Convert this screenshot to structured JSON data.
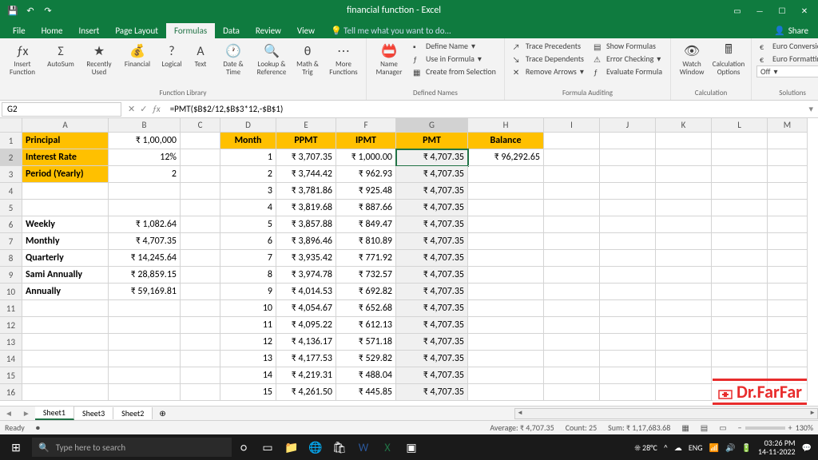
{
  "titlebar": {
    "title": "financial function - Excel"
  },
  "tabs": [
    "File",
    "Home",
    "Insert",
    "Page Layout",
    "Formulas",
    "Data",
    "Review",
    "View"
  ],
  "active_tab": "Formulas",
  "tellme": "Tell me what you want to do...",
  "share": "Share",
  "ribbon": {
    "insertfn": "Insert Function",
    "autosum": "AutoSum",
    "recent": "Recently Used",
    "financial": "Financial",
    "logical": "Logical",
    "text": "Text",
    "datetime": "Date & Time",
    "lookup": "Lookup & Reference",
    "math": "Math & Trig",
    "morefn": "More Functions",
    "g1": "Function Library",
    "namemgr": "Name Manager",
    "defname": "Define Name",
    "useinf": "Use in Formula",
    "createsel": "Create from Selection",
    "g2": "Defined Names",
    "traceprec": "Trace Precedents",
    "tracedep": "Trace Dependents",
    "remarr": "Remove Arrows",
    "showf": "Show Formulas",
    "errchk": "Error Checking",
    "evalf": "Evaluate Formula",
    "g3": "Formula Auditing",
    "watch": "Watch Window",
    "calcopt": "Calculation Options",
    "g4": "Calculation",
    "euroconv": "Euro Conversion",
    "eurofmt": "Euro Formatting",
    "off": "Off",
    "g5": "Solutions"
  },
  "namebox": "G2",
  "formula": "=PMT($B$2/12,$B$3*12,-$B$1)",
  "cols": [
    "A",
    "B",
    "C",
    "D",
    "E",
    "F",
    "G",
    "H",
    "I",
    "J",
    "K",
    "L",
    "M"
  ],
  "labels": {
    "principal": "Principal",
    "irate": "Interest Rate",
    "period": "Period (Yearly)",
    "weekly": "Weekly",
    "monthly": "Monthly",
    "quarterly": "Quarterly",
    "sami": "Sami Annually",
    "annually": "Annually",
    "month": "Month",
    "ppmt": "PPMT",
    "ipmt": "IPMT",
    "pmt": "PMT",
    "balance": "Balance"
  },
  "vals": {
    "principal": "₹ 1,00,000",
    "irate": "12%",
    "period": "2",
    "weekly": "₹ 1,082.64",
    "monthly": "₹ 4,707.35",
    "quarterly": "₹ 14,245.64",
    "sami": "₹ 28,859.15",
    "annually": "₹ 59,169.81",
    "balance1": "₹ 96,292.65"
  },
  "table": [
    {
      "m": "1",
      "p": "₹ 3,707.35",
      "i": "₹ 1,000.00",
      "t": "₹ 4,707.35"
    },
    {
      "m": "2",
      "p": "₹ 3,744.42",
      "i": "₹ 962.93",
      "t": "₹ 4,707.35"
    },
    {
      "m": "3",
      "p": "₹ 3,781.86",
      "i": "₹ 925.48",
      "t": "₹ 4,707.35"
    },
    {
      "m": "4",
      "p": "₹ 3,819.68",
      "i": "₹ 887.66",
      "t": "₹ 4,707.35"
    },
    {
      "m": "5",
      "p": "₹ 3,857.88",
      "i": "₹ 849.47",
      "t": "₹ 4,707.35"
    },
    {
      "m": "6",
      "p": "₹ 3,896.46",
      "i": "₹ 810.89",
      "t": "₹ 4,707.35"
    },
    {
      "m": "7",
      "p": "₹ 3,935.42",
      "i": "₹ 771.92",
      "t": "₹ 4,707.35"
    },
    {
      "m": "8",
      "p": "₹ 3,974.78",
      "i": "₹ 732.57",
      "t": "₹ 4,707.35"
    },
    {
      "m": "9",
      "p": "₹ 4,014.53",
      "i": "₹ 692.82",
      "t": "₹ 4,707.35"
    },
    {
      "m": "10",
      "p": "₹ 4,054.67",
      "i": "₹ 652.68",
      "t": "₹ 4,707.35"
    },
    {
      "m": "11",
      "p": "₹ 4,095.22",
      "i": "₹ 612.13",
      "t": "₹ 4,707.35"
    },
    {
      "m": "12",
      "p": "₹ 4,136.17",
      "i": "₹ 571.18",
      "t": "₹ 4,707.35"
    },
    {
      "m": "13",
      "p": "₹ 4,177.53",
      "i": "₹ 529.82",
      "t": "₹ 4,707.35"
    },
    {
      "m": "14",
      "p": "₹ 4,219.31",
      "i": "₹ 488.04",
      "t": "₹ 4,707.35"
    },
    {
      "m": "15",
      "p": "₹ 4,261.50",
      "i": "₹ 445.85",
      "t": "₹ 4,707.35"
    }
  ],
  "sheets": [
    "Sheet1",
    "Sheet3",
    "Sheet2"
  ],
  "status": {
    "ready": "Ready",
    "avg": "Average: ₹ 4,707.35",
    "count": "Count: 25",
    "sum": "Sum: ₹ 1,17,683.68",
    "zoom": "130%"
  },
  "taskbar": {
    "search": "Type here to search",
    "temp": "28°C",
    "date": "14-11-2022",
    "time": "03:26 PM",
    "lang": "ENG"
  },
  "watermark": "Dr.FarFar"
}
